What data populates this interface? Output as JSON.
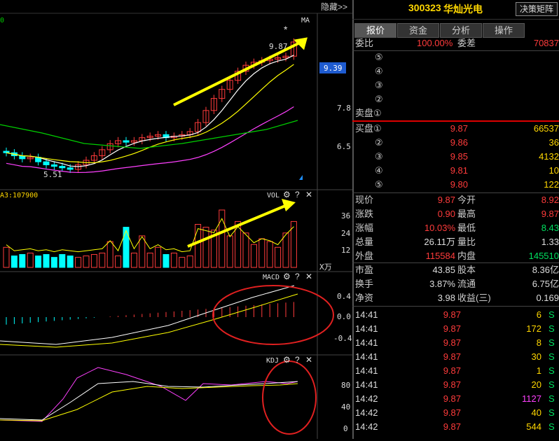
{
  "chart_area": {
    "hide_btn": "隐藏>>",
    "top_left_mark": "0",
    "ma_label": "MA",
    "star": "*",
    "high_label": "9.87",
    "low_label": "5.51",
    "current_price_tag": "9.39",
    "price_axis": [
      "7.8",
      "6.5"
    ],
    "vol_left_label": "A3:107900",
    "vol_tag": "VOL",
    "vol_axis": [
      "36",
      "24",
      "12"
    ],
    "vol_unit": "X万",
    "macd_tag": "MACD",
    "macd_axis": [
      "0.4",
      "0.0",
      "-0.4"
    ],
    "kdj_tag": "KDJ",
    "kdj_axis": [
      "80",
      "40",
      "0"
    ],
    "tool_gear": "⚙",
    "tool_help": "?",
    "tool_close": "✕"
  },
  "header": {
    "code": "300323",
    "name": "华灿光电",
    "button": "决策矩阵"
  },
  "tabs": [
    "报价",
    "资金",
    "分析",
    "操作"
  ],
  "weibi": {
    "label1": "委比",
    "value1": "100.00%",
    "label2": "委差",
    "value2": "70837"
  },
  "sell_levels": [
    "⑤",
    "④",
    "③",
    "②",
    "卖盘①"
  ],
  "buy_levels": [
    {
      "label": "买盘①",
      "price": "9.87",
      "vol": "66537"
    },
    {
      "label": "②",
      "price": "9.86",
      "vol": "36"
    },
    {
      "label": "③",
      "price": "9.85",
      "vol": "4132"
    },
    {
      "label": "④",
      "price": "9.81",
      "vol": "10"
    },
    {
      "label": "⑤",
      "price": "9.80",
      "vol": "122"
    }
  ],
  "quote": [
    {
      "k1": "现价",
      "v1": "9.87",
      "k2": "今开",
      "v2": "8.92"
    },
    {
      "k1": "涨跌",
      "v1": "0.90",
      "k2": "最高",
      "v2": "9.87"
    },
    {
      "k1": "涨幅",
      "v1": "10.03%",
      "k2": "最低",
      "v2": "8.43"
    },
    {
      "k1": "总量",
      "v1": "26.11万",
      "k2": "量比",
      "v2": "1.33"
    },
    {
      "k1": "外盘",
      "v1": "115584",
      "k2": "内盘",
      "v2": "145510"
    }
  ],
  "fundamentals": [
    {
      "k1": "市盈",
      "v1": "43.85",
      "k2": "股本",
      "v2": "8.36亿"
    },
    {
      "k1": "换手",
      "v1": "3.87%",
      "k2": "流通",
      "v2": "6.75亿"
    },
    {
      "k1": "净资",
      "v1": "3.98",
      "k2": "收益(三)",
      "v2": "0.169"
    }
  ],
  "ticks": [
    {
      "time": "14:41",
      "price": "9.87",
      "vol": "6",
      "side": "S"
    },
    {
      "time": "14:41",
      "price": "9.87",
      "vol": "172",
      "side": "S"
    },
    {
      "time": "14:41",
      "price": "9.87",
      "vol": "8",
      "side": "S"
    },
    {
      "time": "14:41",
      "price": "9.87",
      "vol": "30",
      "side": "S"
    },
    {
      "time": "14:41",
      "price": "9.87",
      "vol": "1",
      "side": "S"
    },
    {
      "time": "14:41",
      "price": "9.87",
      "vol": "20",
      "side": "S"
    },
    {
      "time": "14:42",
      "price": "9.87",
      "vol": "1127",
      "side": "S"
    },
    {
      "time": "14:42",
      "price": "9.87",
      "vol": "40",
      "side": "S"
    },
    {
      "time": "14:42",
      "price": "9.87",
      "vol": "544",
      "side": "S"
    }
  ],
  "colors": {
    "up": "#ff3b3b",
    "down": "#00ffff",
    "ma5": "#ffffff",
    "ma10": "#ffff00",
    "ma20": "#ff40ff",
    "ma60": "#00d000"
  }
}
